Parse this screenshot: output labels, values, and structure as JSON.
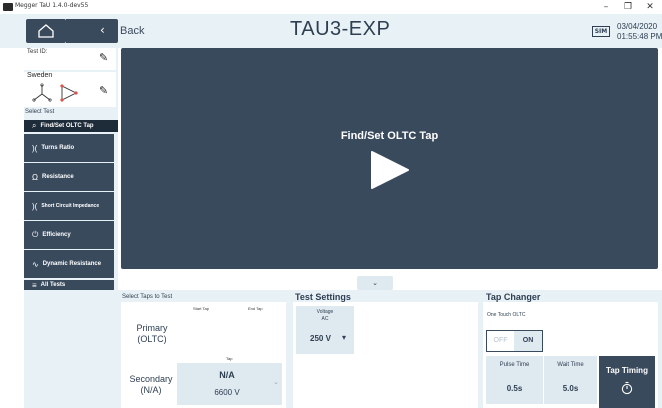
{
  "window": {
    "title": "Megger TaU 1.4.0-dev55",
    "minimize": "–",
    "maximize": "❐",
    "close": "✕"
  },
  "header": {
    "back_label": "Back",
    "title": "TAU3-EXP",
    "sim_badge": "SIM",
    "date": "03/04/2020",
    "time": "01:55:48 PM"
  },
  "sidebar": {
    "test_id_label": "Test ID:",
    "config_name": "Sweden",
    "select_test_label": "Select Test",
    "items": [
      {
        "label": "Find/Set OLTC Tap",
        "icon": "search-icon",
        "selected": true
      },
      {
        "label": "Turns Ratio",
        "icon": "coil-icon"
      },
      {
        "label": "Resistance",
        "icon": "omega-icon"
      },
      {
        "label": "Short Circuit Impedance",
        "icon": "coil-icon"
      },
      {
        "label": "Efficiency",
        "icon": "plug-icon"
      },
      {
        "label": "Dynamic Resistance",
        "icon": "waveform-icon"
      },
      {
        "label": "All Tests",
        "icon": "list-icon"
      }
    ]
  },
  "video": {
    "title": "Find/Set OLTC Tap"
  },
  "taps": {
    "title": "Select Taps to Test",
    "start_tap_label": "Start Tap",
    "end_tap_label": "End Tap",
    "primary_label": "Primary",
    "primary_sub": "(OLTC)",
    "tap_label": "Tap",
    "secondary_label": "Secondary",
    "secondary_sub": "(N/A)",
    "secondary_tap_value": "N/A",
    "secondary_voltage": "6600 V"
  },
  "test_settings": {
    "title": "Test Settings",
    "voltage_label": "Voltage",
    "voltage_sub": "AC",
    "voltage_value": "250 V"
  },
  "tap_changer": {
    "title": "Tap Changer",
    "one_touch_label": "One Touch OLTC",
    "toggle_off": "OFF",
    "toggle_on": "ON",
    "pulse_time_label": "Pulse Time",
    "pulse_time_value": "0.5s",
    "wait_time_label": "Wait Time",
    "wait_time_value": "5.0s",
    "tap_timing_label": "Tap Timing"
  },
  "colors": {
    "dark_panel": "#3a4a5d",
    "light_bg": "#e8f1f6",
    "selected_nav": "#1e2b38",
    "accent_red": "#d9534f"
  }
}
